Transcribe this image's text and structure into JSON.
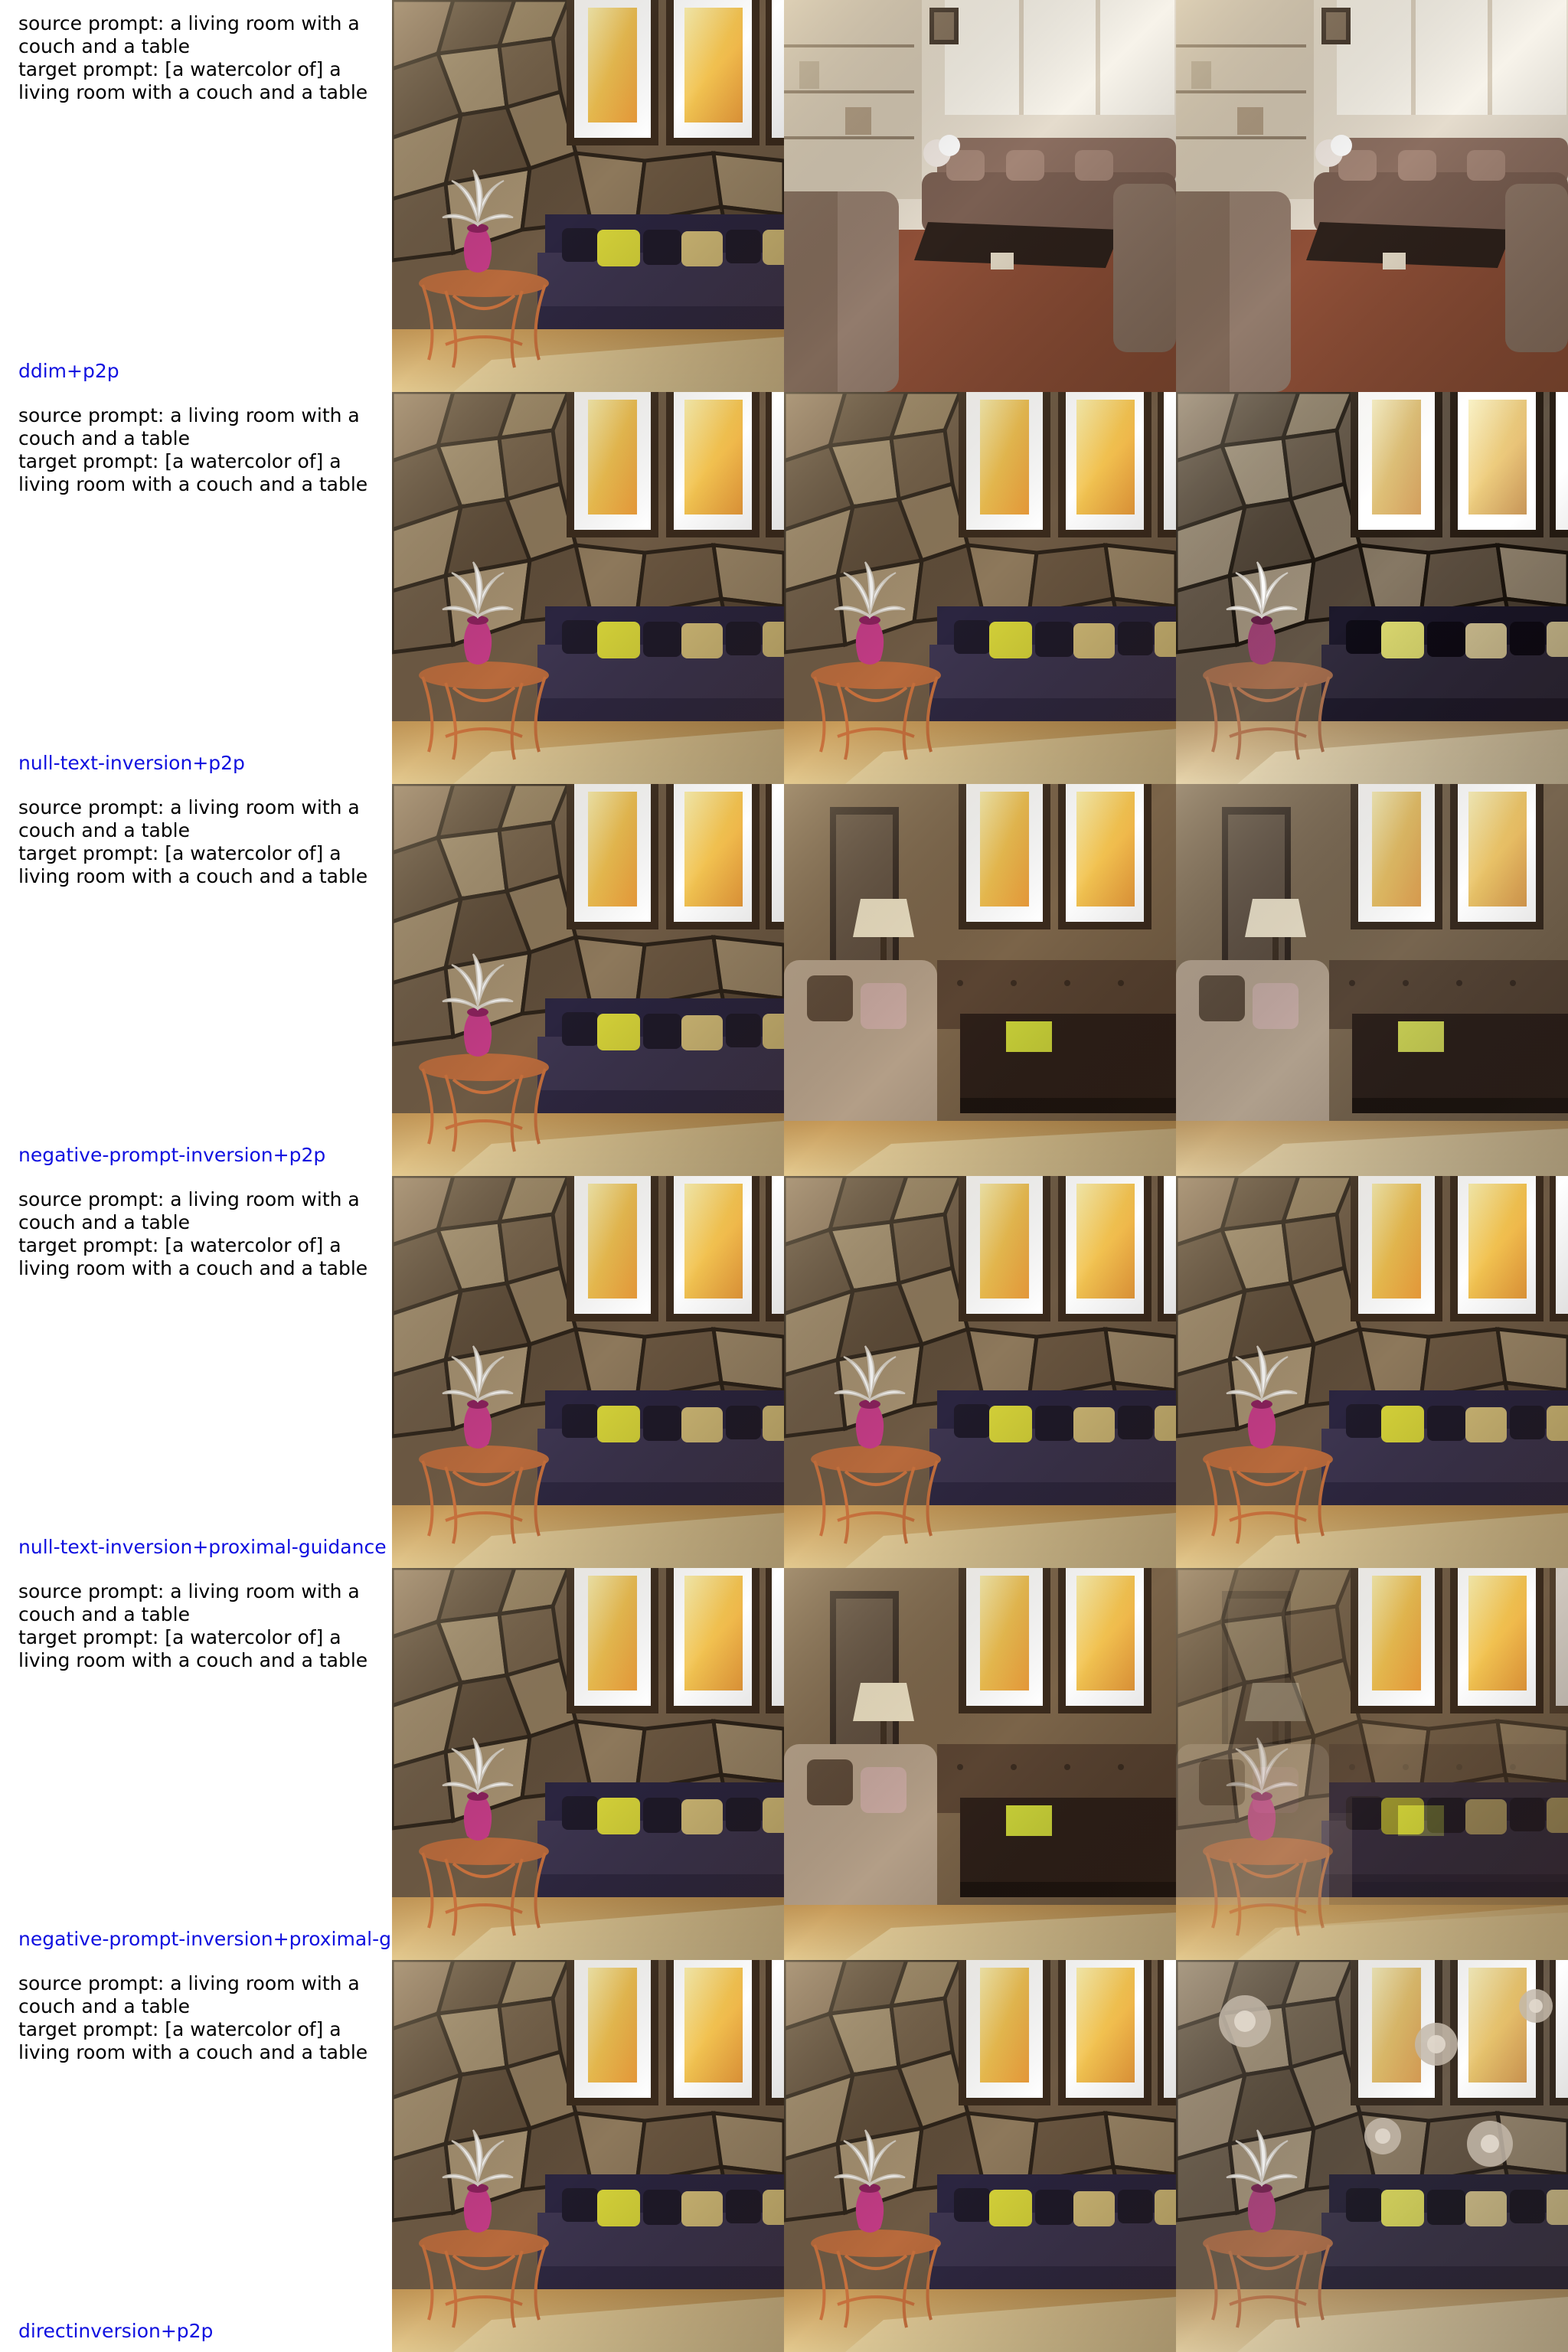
{
  "rows": [
    {
      "method": "ddim+p2p",
      "source_prompt": "source prompt: a living room with a couch and a table",
      "target_prompt": "target prompt: [a watercolor of] a living room with a couch and a table",
      "images": [
        "stone-wall-living-room",
        "modern-living-room-brown-sofa",
        "modern-living-room-brown-sofa"
      ]
    },
    {
      "method": "null-text-inversion+p2p",
      "source_prompt": "source prompt: a living room with a couch and a table",
      "target_prompt": "target prompt: [a watercolor of] a living room with a couch and a table",
      "images": [
        "stone-wall-living-room",
        "stone-wall-living-room",
        "stone-wall-living-room-desaturated"
      ]
    },
    {
      "method": "negative-prompt-inversion+p2p",
      "source_prompt": "source prompt: a living room with a couch and a table",
      "target_prompt": "target prompt: [a watercolor of] a living room with a couch and a table",
      "images": [
        "stone-wall-living-room",
        "living-room-with-lamp-and-dark-table",
        "living-room-with-lamp-and-dark-table"
      ]
    },
    {
      "method": "null-text-inversion+proximal-guidance",
      "source_prompt": "source prompt: a living room with a couch and a table",
      "target_prompt": "target prompt: [a watercolor of] a living room with a couch and a table",
      "images": [
        "stone-wall-living-room",
        "stone-wall-living-room",
        "stone-wall-living-room"
      ]
    },
    {
      "method": "negative-prompt-inversion+proximal-g",
      "source_prompt": "source prompt: a living room with a couch and a table",
      "target_prompt": "target prompt: [a watercolor of] a living room with a couch and a table",
      "images": [
        "stone-wall-living-room",
        "living-room-with-lamp-and-dark-table",
        "stone-wall-living-room-blended"
      ]
    },
    {
      "method": "directinversion+p2p",
      "source_prompt": "source prompt: a living room with a couch and a table",
      "target_prompt": "target prompt: [a watercolor of] a living room with a couch and a table",
      "images": [
        "stone-wall-living-room",
        "stone-wall-living-room",
        "stone-wall-living-room-with-flowers"
      ]
    }
  ],
  "colors": {
    "method_label": "#1010e0",
    "prompt_text": "#000000",
    "wall": "#6e5a44",
    "frame": "#3a2a1c",
    "sofa": "#3d3550",
    "pillow_yellow": "#d9d63a",
    "vase": "#c43b86",
    "floor": "#c79a58"
  }
}
